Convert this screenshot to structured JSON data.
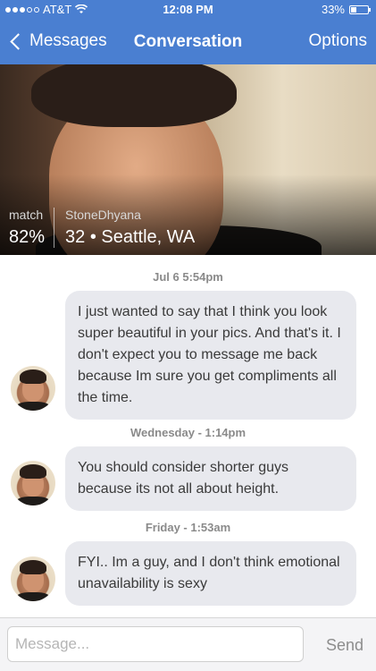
{
  "status": {
    "carrier": "AT&T",
    "time": "12:08 PM",
    "battery": "33%",
    "signal_bars": 5,
    "signal_filled": 3
  },
  "nav": {
    "back_label": "Messages",
    "title": "Conversation",
    "options_label": "Options"
  },
  "profile": {
    "match_label": "match",
    "match_value": "82%",
    "username": "StoneDhyana",
    "age_location": "32 • Seattle, WA"
  },
  "messages": [
    {
      "timestamp": "Jul 6 5:54pm",
      "text": "I just wanted to say that I think you look super beautiful in your pics. And that's it. I don't expect you to message me back because Im sure you get compliments all the time."
    },
    {
      "timestamp": "Wednesday - 1:14pm",
      "text": "You should consider shorter guys because its not all about height."
    },
    {
      "timestamp": "Friday - 1:53am",
      "text": "FYI.. Im a guy, and I don't think emotional unavailability is sexy"
    }
  ],
  "composer": {
    "placeholder": "Message...",
    "send_label": "Send"
  },
  "colors": {
    "header": "#4a7fd1",
    "bubble": "#e8e9ee"
  }
}
